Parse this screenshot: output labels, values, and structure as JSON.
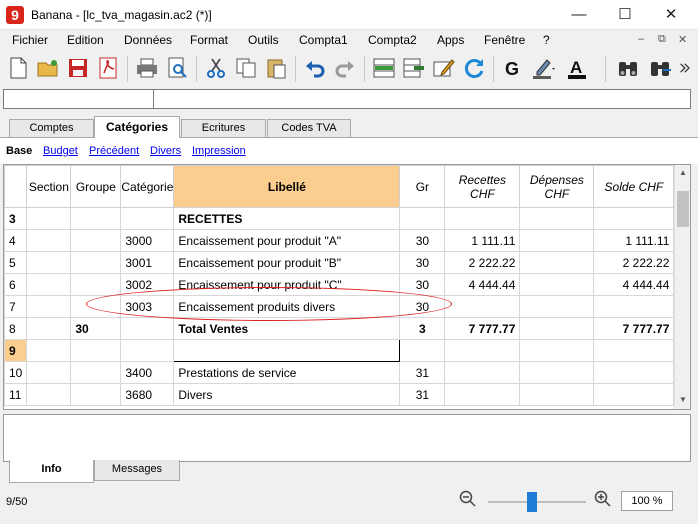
{
  "window": {
    "app_icon": "9",
    "title": "Banana - [lc_tva_magasin.ac2 (*)]"
  },
  "menu": [
    "Fichier",
    "Edition",
    "Données",
    "Format",
    "Outils",
    "Compta1",
    "Compta2",
    "Apps",
    "Fenêtre",
    "?"
  ],
  "tabs": [
    "Comptes",
    "Catégories",
    "Ecritures",
    "Codes TVA"
  ],
  "views": [
    "Base",
    "Budget",
    "Précédent",
    "Divers",
    "Impression"
  ],
  "columns": [
    "Section",
    "Groupe",
    "Catégorie",
    "Libellé",
    "Gr",
    "Recettes CHF",
    "Dépenses CHF",
    "Solde CHF"
  ],
  "rows": [
    {
      "n": "3",
      "section": "",
      "groupe": "",
      "categorie": "",
      "libelle": "RECETTES",
      "gr": "",
      "recettes": "",
      "depenses": "",
      "solde": ""
    },
    {
      "n": "4",
      "section": "",
      "groupe": "",
      "categorie": "3000",
      "libelle": "Encaissement pour produit \"A\"",
      "gr": "30",
      "recettes": "1 111.11",
      "depenses": "",
      "solde": "1 111.11"
    },
    {
      "n": "5",
      "section": "",
      "groupe": "",
      "categorie": "3001",
      "libelle": "Encaissement pour produit \"B\"",
      "gr": "30",
      "recettes": "2 222.22",
      "depenses": "",
      "solde": "2 222.22"
    },
    {
      "n": "6",
      "section": "",
      "groupe": "",
      "categorie": "3002",
      "libelle": "Encaissement pour produit \"C\"",
      "gr": "30",
      "recettes": "4 444.44",
      "depenses": "",
      "solde": "4 444.44"
    },
    {
      "n": "7",
      "section": "",
      "groupe": "",
      "categorie": "3003",
      "libelle": "Encaissement produits divers",
      "gr": "30",
      "recettes": "",
      "depenses": "",
      "solde": ""
    },
    {
      "n": "8",
      "section": "",
      "groupe": "30",
      "categorie": "",
      "libelle": "Total Ventes",
      "gr": "3",
      "recettes": "7 777.77",
      "depenses": "",
      "solde": "7 777.77"
    },
    {
      "n": "9",
      "section": "",
      "groupe": "",
      "categorie": "",
      "libelle": "",
      "gr": "",
      "recettes": "",
      "depenses": "",
      "solde": ""
    },
    {
      "n": "10",
      "section": "",
      "groupe": "",
      "categorie": "3400",
      "libelle": "Prestations de service",
      "gr": "31",
      "recettes": "",
      "depenses": "",
      "solde": ""
    },
    {
      "n": "11",
      "section": "",
      "groupe": "",
      "categorie": "3680",
      "libelle": "Divers",
      "gr": "31",
      "recettes": "",
      "depenses": "",
      "solde": ""
    }
  ],
  "bottom_tabs": [
    "Info",
    "Messages"
  ],
  "status": {
    "position": "9/50",
    "zoom": "100 %",
    "zoom_level": 0.45
  },
  "colors": {
    "header_highlight": "#fbce8f",
    "annotation": "#dd2222",
    "link": "#0000ee"
  }
}
